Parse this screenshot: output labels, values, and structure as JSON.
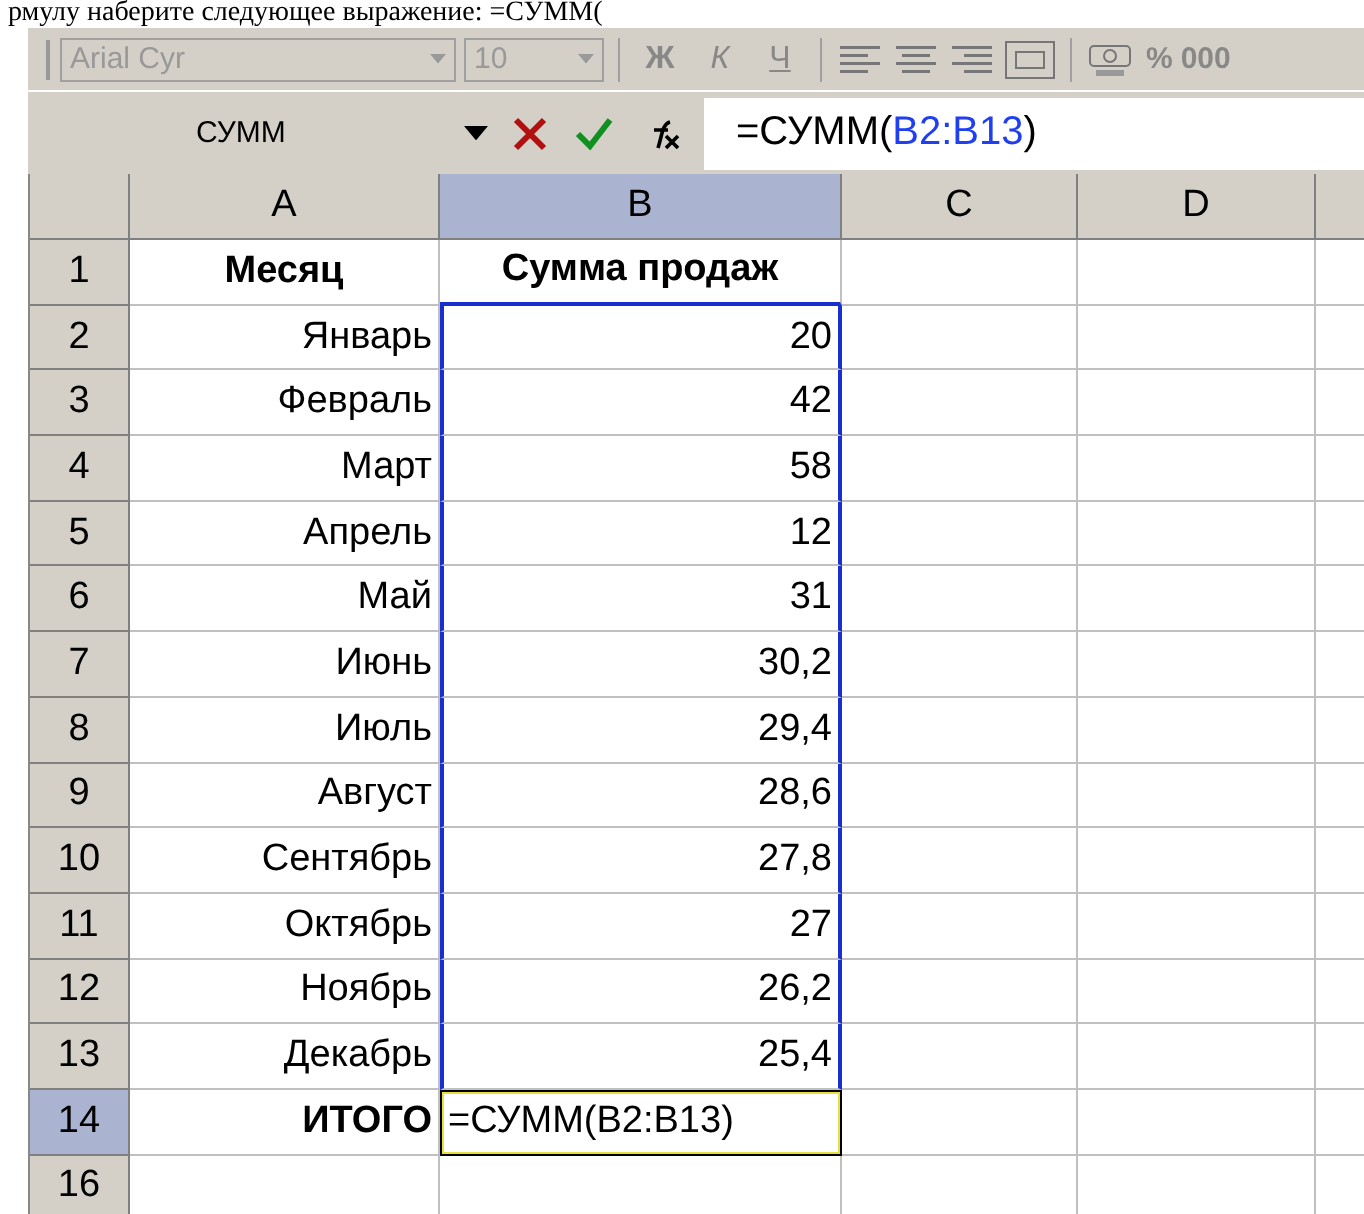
{
  "document_text": "рмулу наберите следующее выражение:  =СУММ(",
  "toolbar": {
    "font": "Arial Cyr",
    "size": "10",
    "format_buttons": [
      {
        "label": "Ж",
        "kind": "bold"
      },
      {
        "label": "К",
        "kind": "italic"
      },
      {
        "label": "Ч",
        "kind": "underline"
      }
    ],
    "percent": "%",
    "thousands": "000"
  },
  "formula_bar": {
    "name_box": "СУММ",
    "formula_prefix": "=СУММ(",
    "formula_ref": "B2:B13",
    "formula_suffix": ")"
  },
  "columns": [
    {
      "label": "A",
      "selected": false
    },
    {
      "label": "B",
      "selected": true
    },
    {
      "label": "C",
      "selected": false
    },
    {
      "label": "D",
      "selected": false
    }
  ],
  "rows": [
    {
      "number": "1",
      "selected": false,
      "cells": [
        {
          "text": "Месяц",
          "bold": true
        },
        {
          "text": "Сумма продаж",
          "bold": true
        }
      ]
    },
    {
      "number": "2",
      "selected": false,
      "cells": [
        {
          "text": "Январь"
        },
        {
          "text": "20",
          "range": true
        }
      ]
    },
    {
      "number": "3",
      "selected": false,
      "cells": [
        {
          "text": "Февраль"
        },
        {
          "text": "42",
          "range": true
        }
      ]
    },
    {
      "number": "4",
      "selected": false,
      "cells": [
        {
          "text": "Март"
        },
        {
          "text": "58",
          "range": true
        }
      ]
    },
    {
      "number": "5",
      "selected": false,
      "cells": [
        {
          "text": "Апрель"
        },
        {
          "text": "12",
          "range": true
        }
      ]
    },
    {
      "number": "6",
      "selected": false,
      "cells": [
        {
          "text": "Май"
        },
        {
          "text": "31",
          "range": true
        }
      ]
    },
    {
      "number": "7",
      "selected": false,
      "cells": [
        {
          "text": "Июнь"
        },
        {
          "text": "30,2",
          "range": true
        }
      ]
    },
    {
      "number": "8",
      "selected": false,
      "cells": [
        {
          "text": "Июль"
        },
        {
          "text": "29,4",
          "range": true
        }
      ]
    },
    {
      "number": "9",
      "selected": false,
      "cells": [
        {
          "text": "Август"
        },
        {
          "text": "28,6",
          "range": true
        }
      ]
    },
    {
      "number": "10",
      "selected": false,
      "cells": [
        {
          "text": "Сентябрь"
        },
        {
          "text": "27,8",
          "range": true
        }
      ]
    },
    {
      "number": "11",
      "selected": false,
      "cells": [
        {
          "text": "Октябрь"
        },
        {
          "text": "27",
          "range": true
        }
      ]
    },
    {
      "number": "12",
      "selected": false,
      "cells": [
        {
          "text": "Ноябрь"
        },
        {
          "text": "26,2",
          "range": true
        }
      ]
    },
    {
      "number": "13",
      "selected": false,
      "cells": [
        {
          "text": "Декабрь"
        },
        {
          "text": "25,4",
          "range": true
        }
      ]
    },
    {
      "number": "14",
      "selected": true,
      "cells": [
        {
          "text": "ИТОГО",
          "bold": true
        },
        {
          "text": "=СУММ(B2:B13)",
          "editing": true
        }
      ]
    },
    {
      "number": "16",
      "selected": false,
      "cells": []
    }
  ]
}
